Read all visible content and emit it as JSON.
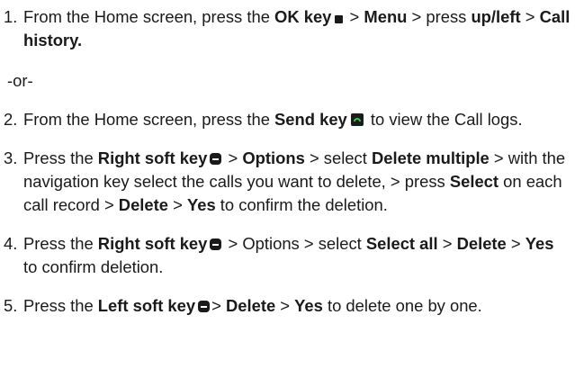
{
  "steps": [
    {
      "number": "1.",
      "parts": {
        "p1": "From the Home screen, press the ",
        "b1": "OK key",
        "p2": " > ",
        "b2": "Menu",
        "p3": " > press ",
        "b3": "up/left",
        "p4": " > ",
        "b4": "Call history."
      }
    },
    {
      "number": "2.",
      "parts": {
        "p1": "From the Home screen, press the ",
        "b1": "Send key",
        "p2": " to view the Call logs."
      }
    },
    {
      "number": "3.",
      "parts": {
        "p1": "Press the ",
        "b1": "Right soft key",
        "p2": " > ",
        "b2": "Options",
        "p3": " > select ",
        "b3": "Delete multiple",
        "p4": " > with the navigation key select the calls you want to delete, > press ",
        "b4": "Select",
        "p5": " on each call record > ",
        "b5": "Delete",
        "p6": " > ",
        "b6": "Yes",
        "p7": " to confirm the deletion."
      }
    },
    {
      "number": "4.",
      "parts": {
        "p1": "Press the ",
        "b1": "Right soft key",
        "p2": " > Options > select ",
        "b2": "Select all",
        "p3": " > ",
        "b3": "Delete",
        "p4": " > ",
        "b4": "Yes",
        "p5": " to confirm deletion."
      }
    },
    {
      "number": "5.",
      "parts": {
        "p1": "Press the ",
        "b1": "Left soft key",
        "p2": "> ",
        "b2": "Delete",
        "p3": " > ",
        "b3": "Yes",
        "p4": " to delete one by one."
      }
    }
  ],
  "separator": "-or-",
  "icons": {
    "ok": "ok-key-icon",
    "send": "send-key-icon",
    "soft": "soft-key-icon"
  },
  "colors": {
    "text": "#1a1a1a",
    "send_icon_green": "#2ecc40"
  }
}
